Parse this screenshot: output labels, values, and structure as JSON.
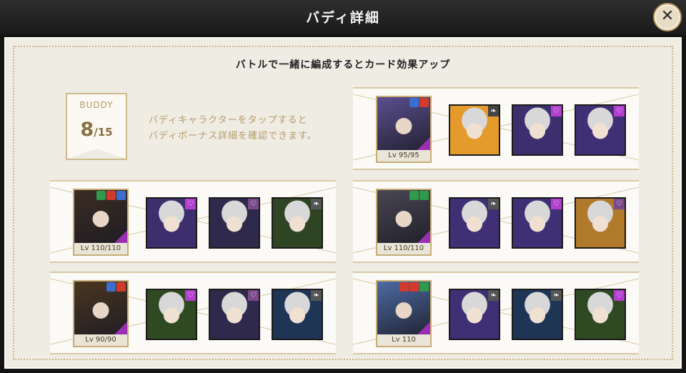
{
  "window": {
    "title": "バディ詳細"
  },
  "close_button": {
    "icon": "close-icon",
    "glyph": "✕"
  },
  "header": {
    "subtitle": "バトルで一緒に編成するとカード効果アップ"
  },
  "buddy": {
    "label": "BUDDY",
    "count": "8",
    "total": "/15"
  },
  "hint": {
    "line1": "バディキャラクターをタップすると",
    "line2": "バディボーナス詳細を確認できます。"
  },
  "colors": {
    "accent_gold": "#c7ad76",
    "heart_purple": "#b33fcf",
    "level_text": "#4a3d25"
  },
  "cards": [
    {
      "id": "top-right",
      "main": {
        "level": "Lv 95/95",
        "tags": [
          "#3a6fd0",
          "#d23b2b"
        ],
        "bg": "#5b4f8f"
      },
      "buddies": [
        {
          "bg": "#e59a2c",
          "badge": "heart-icon",
          "badge_bg": "#444",
          "glyph": "❧"
        },
        {
          "bg": "#3d2f6e",
          "badge": "heart-icon",
          "badge_bg": "#b33fcf",
          "glyph": "♡"
        },
        {
          "bg": "#3f2f74",
          "badge": "heart-icon",
          "badge_bg": "#b33fcf",
          "glyph": "♡"
        }
      ]
    },
    {
      "id": "mid-left",
      "main": {
        "level": "Lv 110/110",
        "tags": [
          "#2f9a4b",
          "#d23b2b",
          "#3a6fd0"
        ],
        "bg": "#3b2c22"
      },
      "buddies": [
        {
          "bg": "#3d2f6e",
          "badge": "heart-icon",
          "badge_bg": "#b33fcf",
          "glyph": "♡"
        },
        {
          "bg": "#2f2a4c",
          "badge": "heart-icon",
          "badge_bg": "#7a4a8a",
          "glyph": "♡"
        },
        {
          "bg": "#2e4422",
          "badge": "leaf-icon",
          "badge_bg": "#555",
          "glyph": "❧"
        }
      ]
    },
    {
      "id": "mid-right",
      "main": {
        "level": "Lv 110/110",
        "tags": [
          "#2f9a4b",
          "#2f9a4b"
        ],
        "bg": "#4a4654"
      },
      "buddies": [
        {
          "bg": "#3f2f74",
          "badge": "leaf-icon",
          "badge_bg": "#555",
          "glyph": "❧"
        },
        {
          "bg": "#3f2f74",
          "badge": "heart-icon",
          "badge_bg": "#b33fcf",
          "glyph": "♡"
        },
        {
          "bg": "#b07a2a",
          "badge": "heart-icon",
          "badge_bg": "#7a4a8a",
          "glyph": "♡"
        }
      ]
    },
    {
      "id": "bottom-left",
      "main": {
        "level": "Lv 90/90",
        "tags": [
          "#3a6fd0",
          "#d23b2b"
        ],
        "bg": "#4a3620"
      },
      "buddies": [
        {
          "bg": "#2f4a22",
          "badge": "heart-icon",
          "badge_bg": "#b33fcf",
          "glyph": "♡"
        },
        {
          "bg": "#2f2a4c",
          "badge": "heart-icon",
          "badge_bg": "#7a4a8a",
          "glyph": "♡"
        },
        {
          "bg": "#1f3556",
          "badge": "leaf-icon",
          "badge_bg": "#555",
          "glyph": "❧"
        }
      ]
    },
    {
      "id": "bottom-right",
      "main": {
        "level": "Lv 110",
        "tags": [
          "#d23b2b",
          "#d23b2b",
          "#2f9a4b"
        ],
        "bg": "#4d6aa3"
      },
      "buddies": [
        {
          "bg": "#3f2f74",
          "badge": "leaf-icon",
          "badge_bg": "#555",
          "glyph": "❧"
        },
        {
          "bg": "#1f3556",
          "badge": "leaf-icon",
          "badge_bg": "#555",
          "glyph": "❧"
        },
        {
          "bg": "#2f4a22",
          "badge": "heart-icon",
          "badge_bg": "#b33fcf",
          "glyph": "♡"
        }
      ]
    }
  ]
}
